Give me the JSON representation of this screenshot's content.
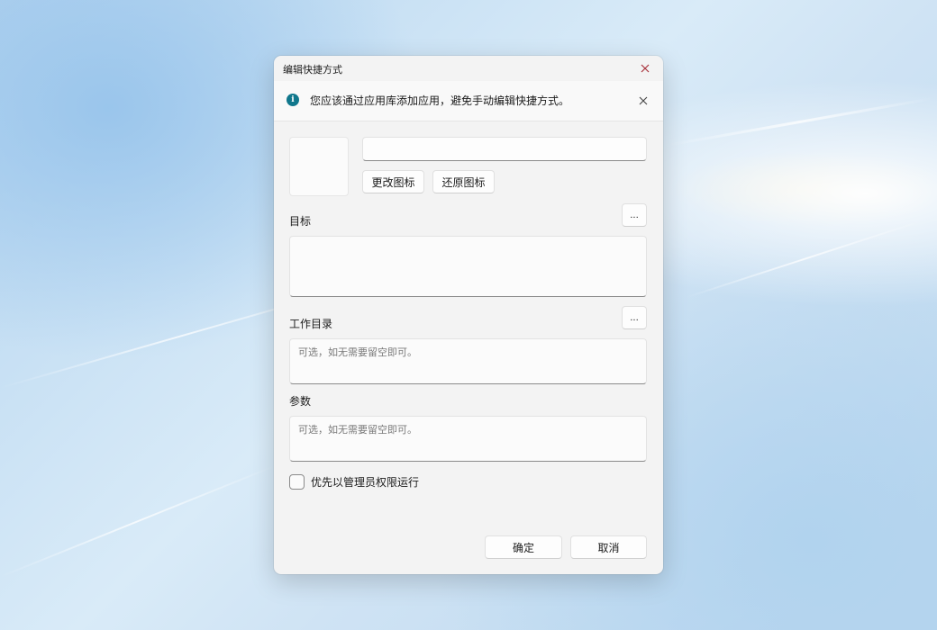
{
  "dialog": {
    "title": "编辑快捷方式",
    "info_message": "您应该通过应用库添加应用，避免手动编辑快捷方式。",
    "name_value": "",
    "change_icon_label": "更改图标",
    "restore_icon_label": "还原图标",
    "target": {
      "label": "目标",
      "browse_label": "...",
      "value": ""
    },
    "working_dir": {
      "label": "工作目录",
      "browse_label": "...",
      "placeholder": "可选，如无需要留空即可。"
    },
    "arguments": {
      "label": "参数",
      "placeholder": "可选，如无需要留空即可。"
    },
    "run_as_admin": {
      "label": "优先以管理员权限运行",
      "checked": false
    },
    "ok_label": "确定",
    "cancel_label": "取消"
  },
  "colors": {
    "info_icon": "#10778c",
    "close_icon": "#a8323c",
    "dialog_bg": "#f3f3f3"
  },
  "icons": {
    "close": "close-icon",
    "info": "info-icon"
  }
}
